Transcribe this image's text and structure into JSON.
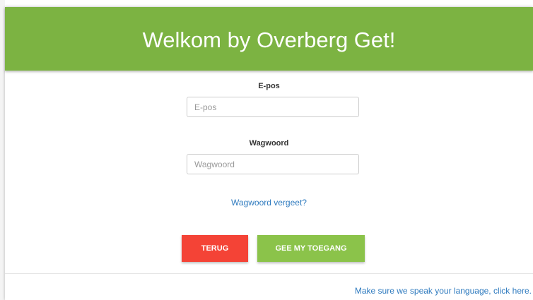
{
  "header": {
    "title": "Welkom by Overberg Get!"
  },
  "form": {
    "email": {
      "label": "E-pos",
      "placeholder": "E-pos",
      "value": ""
    },
    "password": {
      "label": "Wagwoord",
      "placeholder": "Wagwoord",
      "value": ""
    },
    "forgot_link": "Wagwoord vergeet?",
    "back_button": "TERUG",
    "submit_button": "GEE MY TOEGANG"
  },
  "footer": {
    "language_link": "Make sure we speak your language, click here."
  },
  "colors": {
    "header": "#7cb342",
    "back_button": "#f44336",
    "submit_button": "#8bc34a",
    "link": "#2f7bbf"
  }
}
